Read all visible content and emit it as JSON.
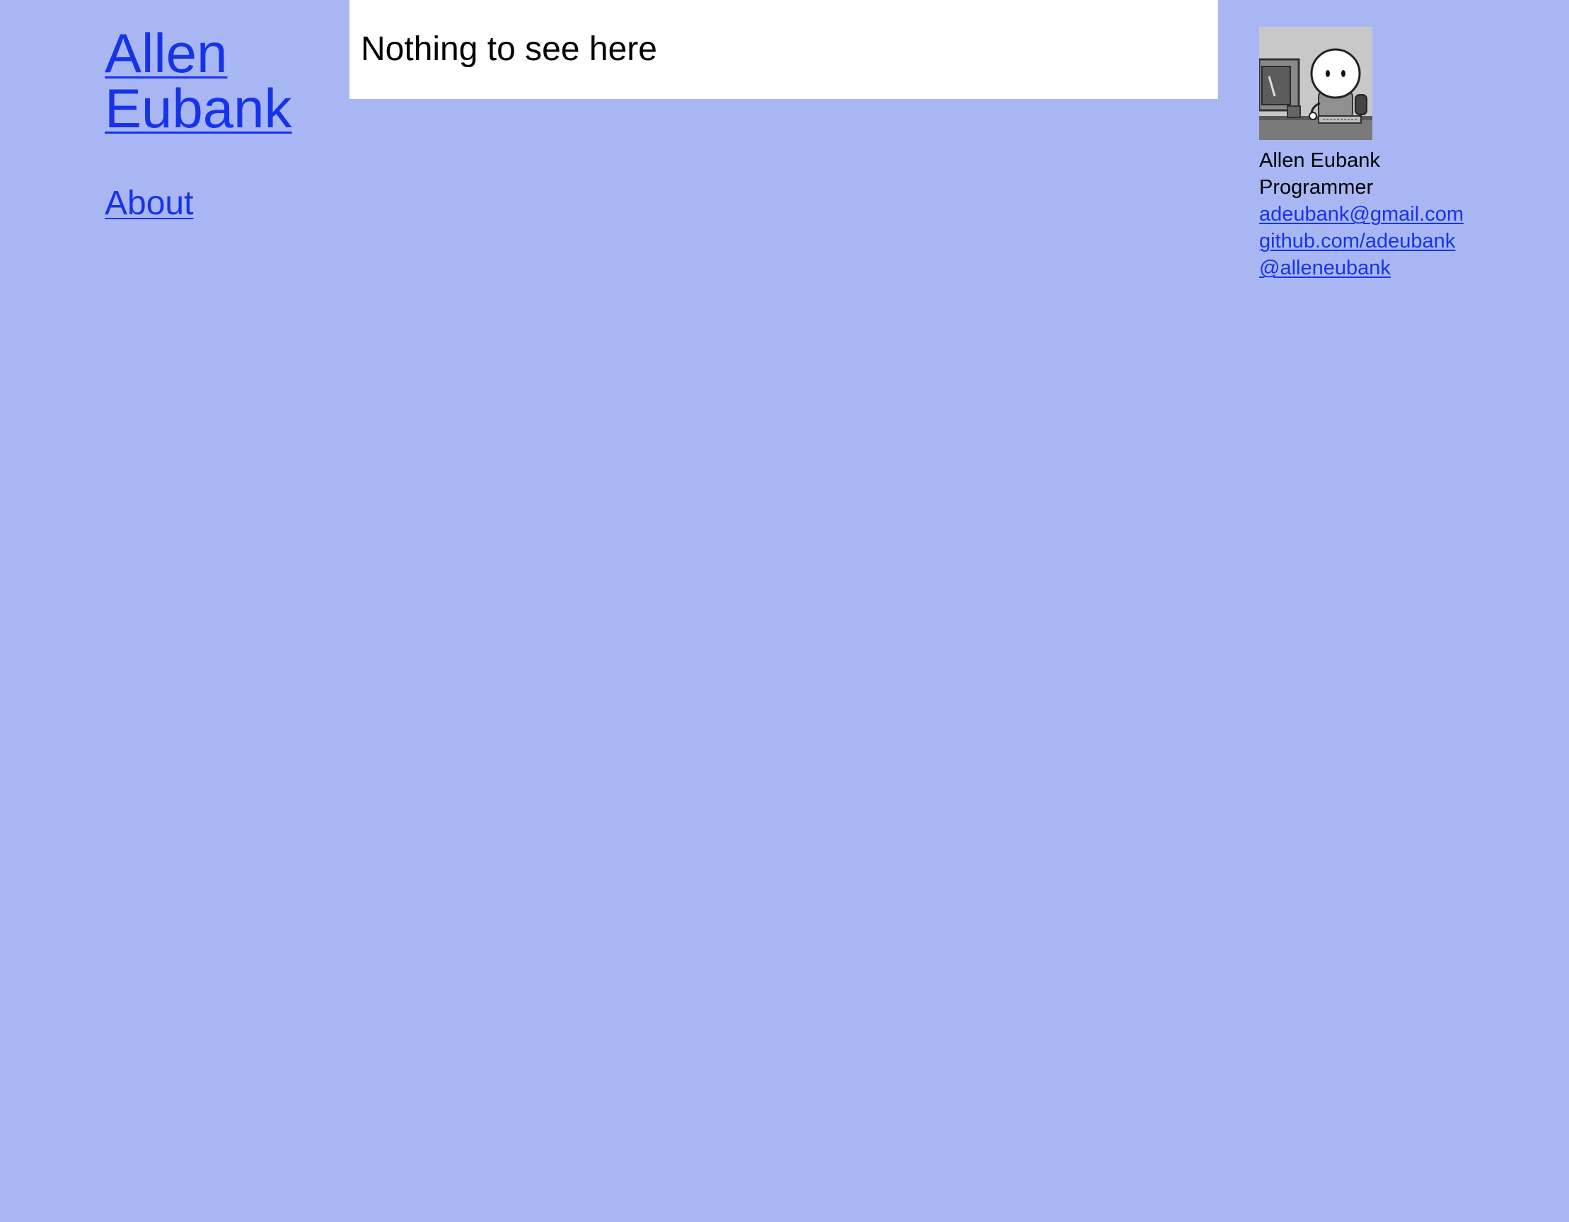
{
  "header": {
    "site_title_line1": "Allen",
    "site_title_line2": "Eubank"
  },
  "nav": {
    "items": [
      {
        "label": "About"
      }
    ]
  },
  "main": {
    "message": "Nothing to see here"
  },
  "profile": {
    "avatar_icon": "cartoon-programmer-avatar",
    "name": "Allen Eubank",
    "role": "Programmer",
    "email": "adeubank@gmail.com",
    "github": "github.com/adeubank",
    "twitter": "@alleneubank"
  },
  "colors": {
    "background": "#a8b7f4",
    "link": "#1733ea",
    "panel": "#ffffff",
    "text": "#000000"
  }
}
